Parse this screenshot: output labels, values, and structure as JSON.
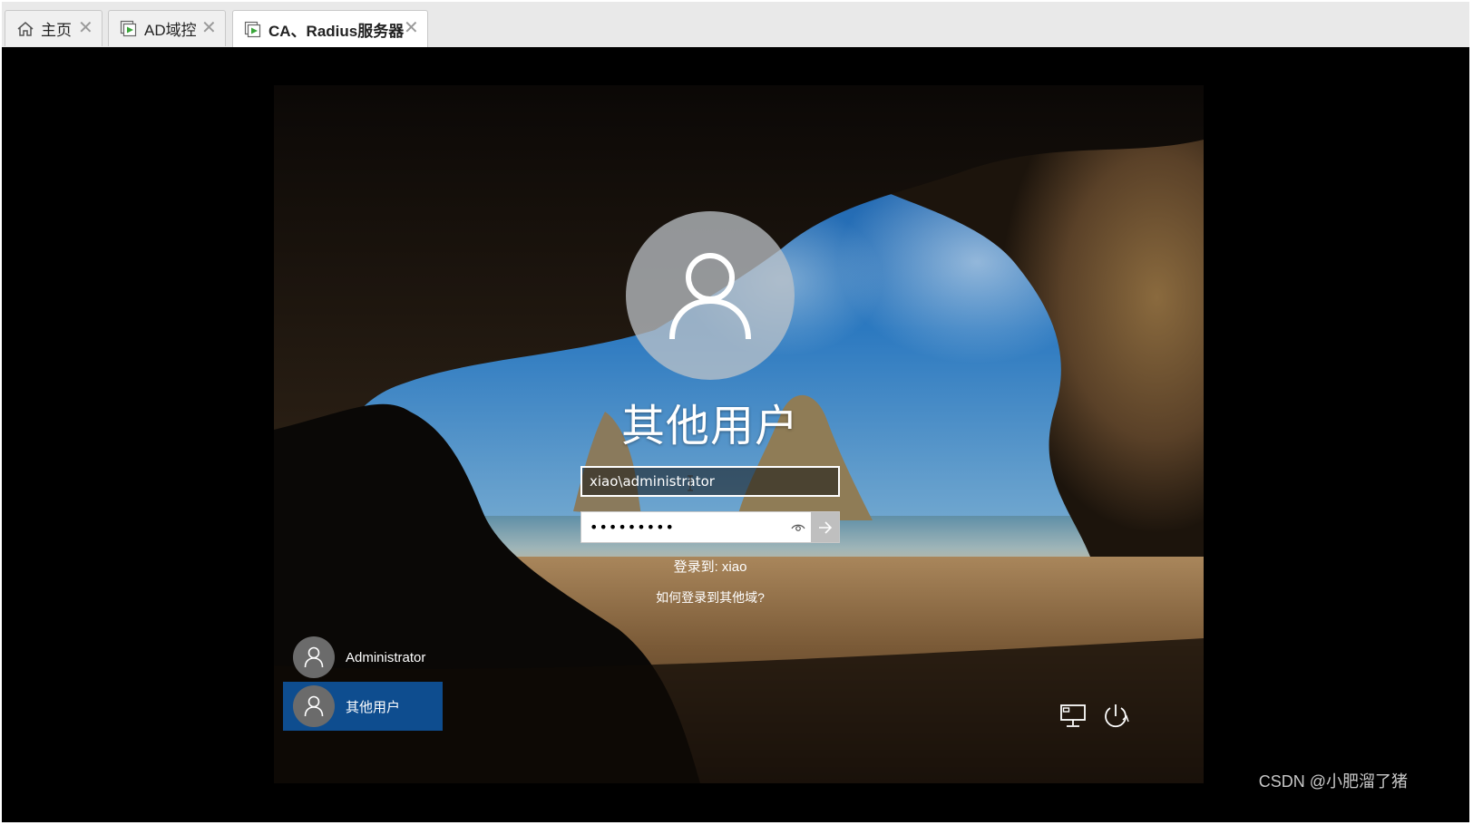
{
  "tabs": [
    {
      "label": "主页",
      "icon": "home-icon"
    },
    {
      "label": "AD域控",
      "icon": "vm-running-icon"
    },
    {
      "label": "CA、Radius服务器",
      "icon": "vm-running-icon"
    }
  ],
  "login": {
    "display_name": "其他用户",
    "username_value": "xiao\\administrator",
    "password_value": "•••••••••",
    "sign_in_to": "登录到: xiao",
    "other_domain_link": "如何登录到其他域?"
  },
  "users": [
    {
      "label": "Administrator"
    },
    {
      "label": "其他用户"
    }
  ],
  "system_icons": [
    "network-icon",
    "power-icon"
  ],
  "watermark": "CSDN @小肥溜了猪",
  "colors": {
    "selected_tile": "#0e4d8f",
    "vm_icon_green": "#3aa53a"
  }
}
